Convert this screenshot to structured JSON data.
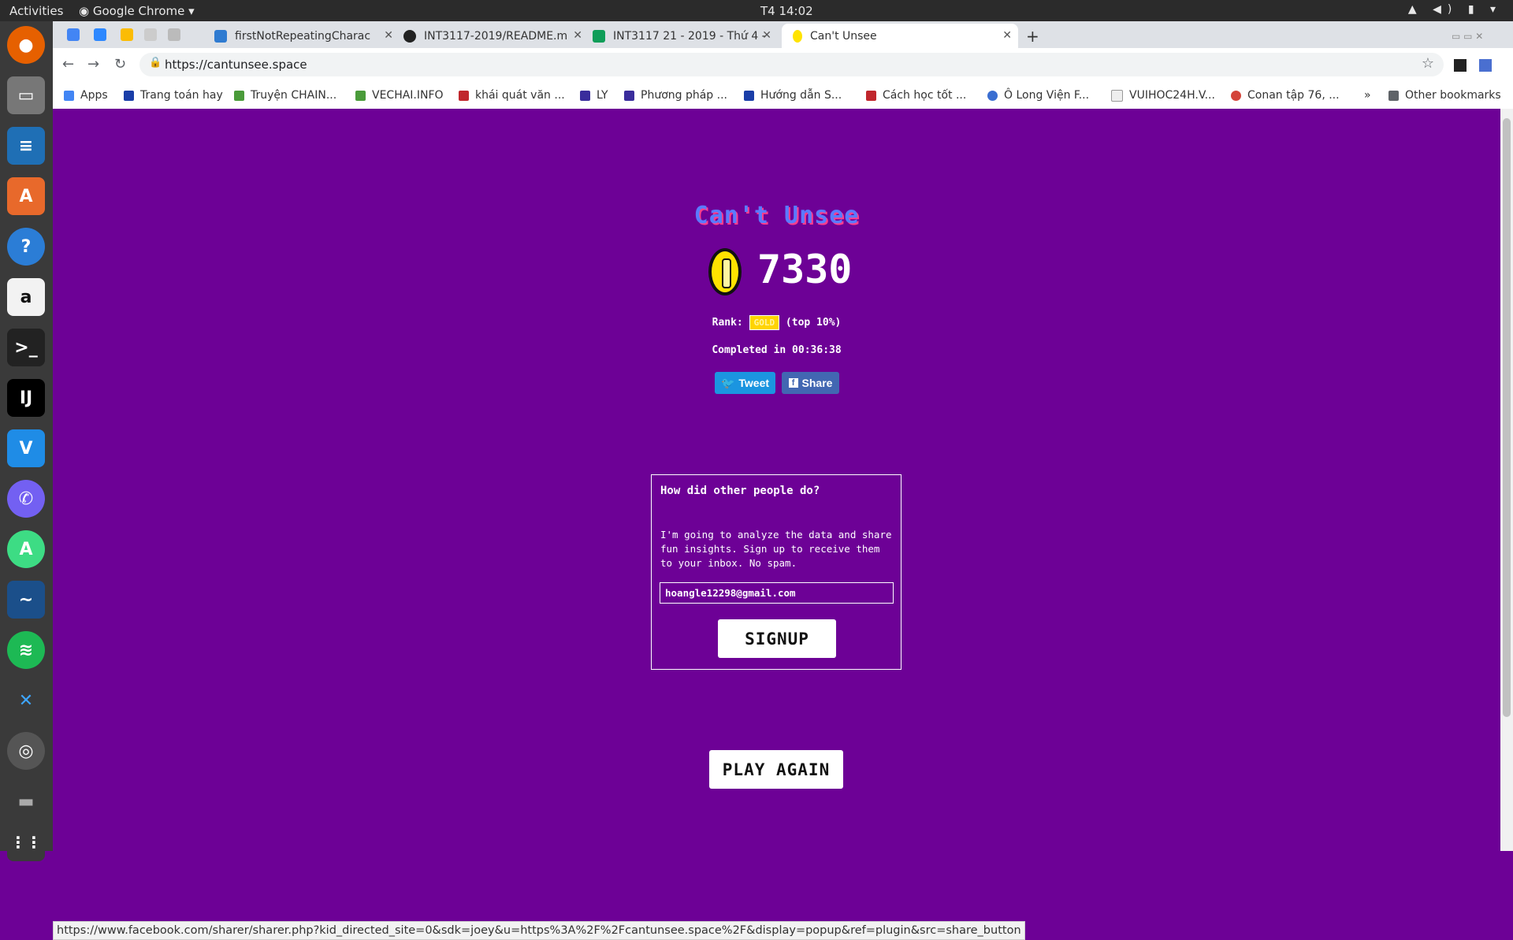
{
  "system": {
    "activities": "Activities",
    "app_name": "Google Chrome",
    "clock": "T4 14:02"
  },
  "tabs": [
    {
      "title": "firstNotRepeatingCharac",
      "icon": "y-icon"
    },
    {
      "title": "INT3117-2019/README.m",
      "icon": "github-icon"
    },
    {
      "title": "INT3117 21 - 2019 - Thứ 4 -",
      "icon": "sheets-icon"
    },
    {
      "title": "Can't Unsee",
      "icon": "coin-icon"
    }
  ],
  "address": {
    "url": "https://cantunsee.space"
  },
  "bookmarks": {
    "apps": "Apps",
    "items": [
      "Trang toán hay",
      "Truyện CHAIN...",
      "VECHAI.INFO",
      "khái quát văn ...",
      "LY",
      "Phương pháp ...",
      "Hướng dẫn S...",
      "Cách học tốt ...",
      "Ô Long Viện F...",
      "VUIHOC24H.V...",
      "Conan tập 76, ..."
    ],
    "more": "»",
    "other": "Other bookmarks"
  },
  "game": {
    "title": "Can't Unsee",
    "score": "7330",
    "rank_label": "Rank:",
    "rank_badge": "GOLD",
    "rank_note": "(top 10%)",
    "completed": "Completed in 00:36:38",
    "tweet": "Tweet",
    "share": "Share"
  },
  "signup_card": {
    "heading": "How did other people do?",
    "body": "I'm going to analyze the data and share fun insights. Sign up to receive them to your inbox. No spam.",
    "email_value": "hoangle12298@gmail.com",
    "button": "SIGNUP"
  },
  "play_again": "PLAY AGAIN",
  "status_url": "https://www.facebook.com/sharer/sharer.php?kid_directed_site=0&sdk=joey&u=https%3A%2F%2Fcantunsee.space%2F&display=popup&ref=plugin&src=share_button",
  "colors": {
    "page_bg": "#6d0196",
    "gold": "#ffd400",
    "tweet": "#1b95e0",
    "share": "#4267b2"
  }
}
